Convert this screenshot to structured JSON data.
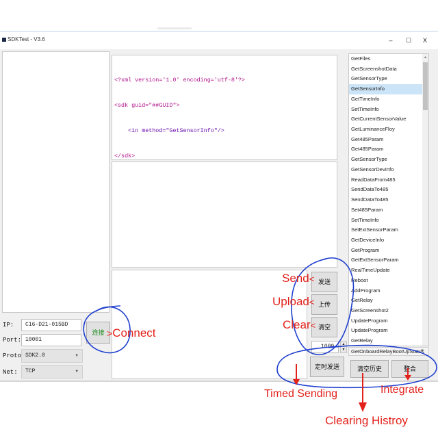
{
  "window": {
    "title": "SDKTest - V3.6",
    "minimize": "–",
    "maximize": "☐",
    "close": "X"
  },
  "request_xml": {
    "lines": [
      {
        "text": "<?xml version='1.0' encoding='utf-8'?>"
      },
      {
        "text": "<sdk guid=\"##GUID\">"
      },
      {
        "text": "    <in method=\"GetSensorInfo\"/>"
      },
      {
        "text": "</sdk>"
      }
    ]
  },
  "connection": {
    "ip_label": "IP:",
    "ip_value": "C16-D21-015BD",
    "port_label": "Port:",
    "port_value": "10001",
    "proto_label": "Proto:",
    "proto_value": "SDK2.0",
    "net_label": "Net:",
    "net_value": "TCP",
    "connect_button": "连接"
  },
  "actions": {
    "send": "发送",
    "upload": "上传",
    "clear": "清空",
    "interval_value": "1000",
    "timed_send": "定时发送",
    "clear_history": "清空历史",
    "integrate": "整合"
  },
  "methods": {
    "selected": "GetSensorInfo",
    "items": [
      "GetFiles",
      "GetScreenshotData",
      "GetSensorType",
      "GetSensorInfo",
      "GetTimeInfo",
      "SetTimeInfo",
      "GetCurrentSensorValue",
      "GetLuminanceFloy",
      "Get485Param",
      "Get485Param",
      "GetSensorType",
      "GetSensorDevInfo",
      "ReadDataFrom485",
      "SendDataTo485",
      "SendDataTo485",
      "Set485Param",
      "SetTimeInfo",
      "SetExtSensorParam",
      "GetDeviceInfo",
      "GetProgram",
      "GetExtSensorParam",
      "RealTimeUpdate",
      "Reboot",
      "AddProgram",
      "GetRelay",
      "GetScreenshot2",
      "UpdateProgram",
      "UpdateProgram",
      "GetRelay"
    ],
    "combo_value": "GetOnboardRelayBootUpStatus"
  },
  "annotations": {
    "send": "Send",
    "upload": "Upload",
    "clear": "Clear",
    "connect": "Connect",
    "timed_sending": "Timed Sending",
    "clearing_history": "Clearing Histroy",
    "integrate": "Integrate",
    "arrow_glyph": "<",
    "connect_arrow_glyph": ">",
    "colors": {
      "red": "#e3221b",
      "blue": "#1f3fcf"
    }
  }
}
